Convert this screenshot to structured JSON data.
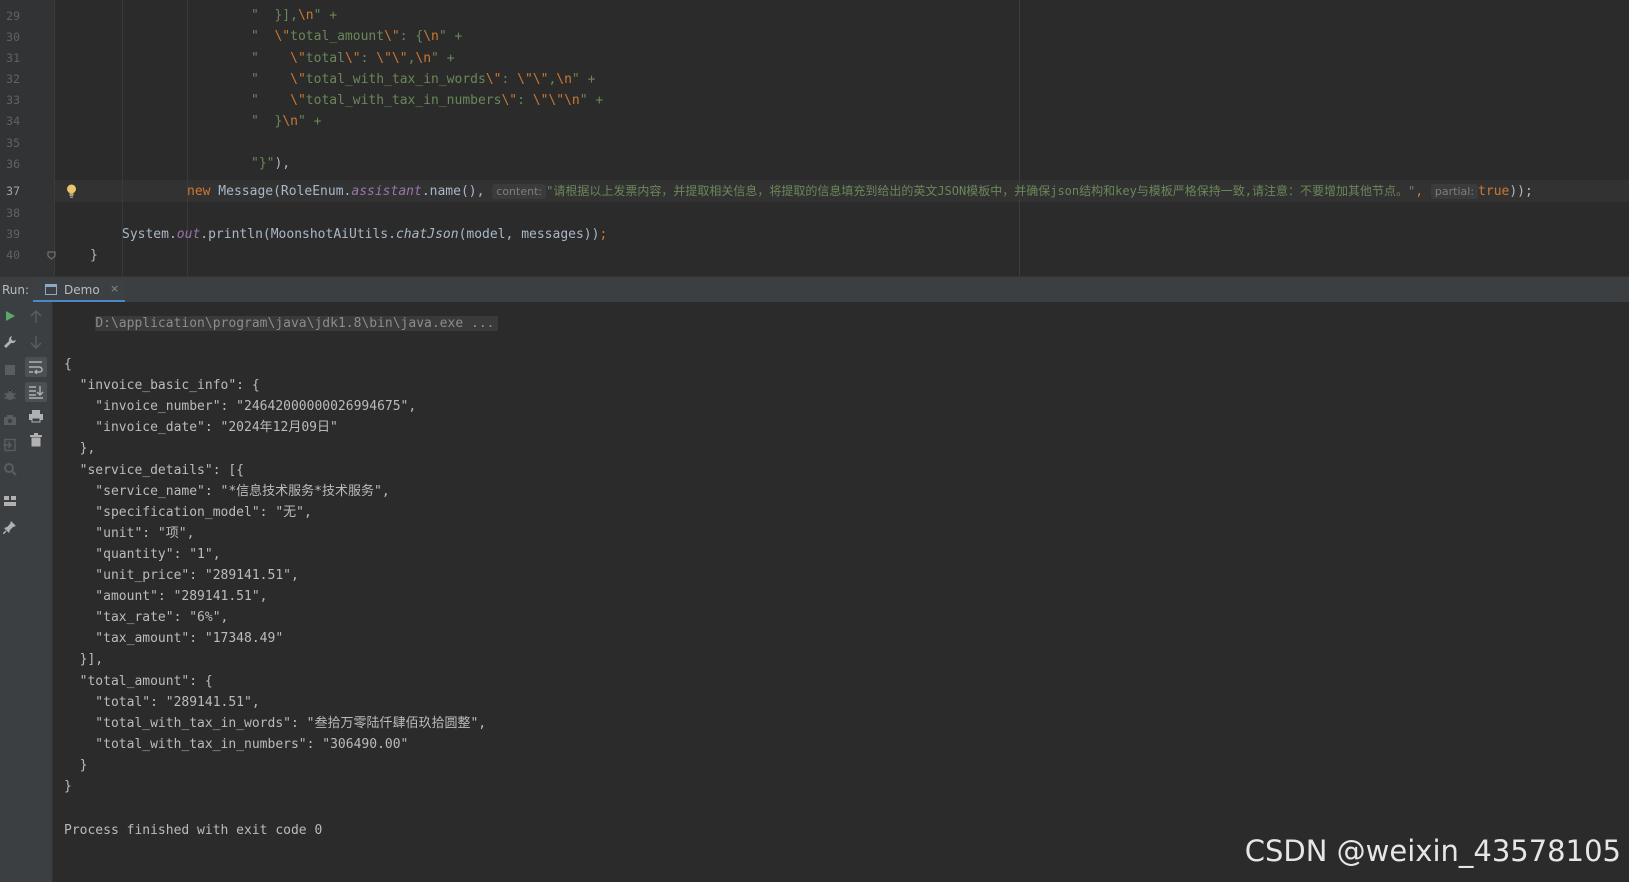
{
  "editor": {
    "line_numbers": [
      "29",
      "30",
      "31",
      "32",
      "33",
      "34",
      "35",
      "36",
      "37",
      "38",
      "39",
      "40"
    ],
    "current_line": "37",
    "lines": {
      "l29": {
        "q": "\"  ",
        "brace": "}],",
        "esc": "\\n",
        "end": "\" +"
      },
      "l30": {
        "q": "\"  ",
        "esc1": "\\\"",
        "key": "total_amount",
        "esc2": "\\\"",
        "mid": ": {",
        "esc3": "\\n",
        "end": "\" +"
      },
      "l31": {
        "q": "\"    ",
        "esc1": "\\\"",
        "key": "total",
        "esc2": "\\\"",
        "mid": ": ",
        "esc3": "\\\"\\\"",
        "comma": ",",
        "esc4": "\\n",
        "end": "\" +"
      },
      "l32": {
        "q": "\"    ",
        "esc1": "\\\"",
        "key": "total_with_tax_in_words",
        "esc2": "\\\"",
        "mid": ": ",
        "esc3": "\\\"\\\"",
        "comma": ",",
        "esc4": "\\n",
        "end": "\" +"
      },
      "l33": {
        "q": "\"    ",
        "esc1": "\\\"",
        "key": "total_with_tax_in_numbers",
        "esc2": "\\\"",
        "mid": ": ",
        "esc3": "\\\"\\\"",
        "esc4": "\\n",
        "end": "\" +"
      },
      "l34": {
        "q": "\"  ",
        "brace": "}",
        "esc": "\\n",
        "end": "\" +"
      },
      "l36": {
        "str": "\"}\"",
        "end": "),"
      },
      "l37": {
        "kw_new": "new",
        "cls": " Message(RoleEnum.",
        "field": "assistant",
        "call": ".name(),",
        "hint_content": "content:",
        "content_str": "\"请根据以上发票内容，并提取相关信息，将提取的信息填充到给出的英文JSON模板中，并确保json结构和key与模板严格保持一致,请注意：不要增加其他节点。\"",
        "comma": ",",
        "hint_partial": "partial:",
        "kw_true": "true",
        "end": "));"
      },
      "l39": {
        "sys": "System.",
        "out": "out",
        "println": ".println(MoonshotAiUtils.",
        "method": "chatJson",
        "args": "(model, messages))",
        "semi": ";"
      },
      "l40": {
        "brace": "}"
      }
    }
  },
  "run_window": {
    "label": "Run:",
    "tab": {
      "label": "Demo",
      "close": "×"
    },
    "tool_icons": [
      "rerun-icon",
      "up-arrow-icon",
      "down-arrow-icon",
      "soft-wrap-icon",
      "scroll-to-end-icon",
      "print-icon",
      "trash-icon",
      "wrench-icon",
      "stop-icon",
      "debug-icon",
      "camera-icon",
      "exit-icon",
      "settings-icon",
      "layout-icon",
      "pin-icon"
    ]
  },
  "console": {
    "command": "D:\\application\\program\\java\\jdk1.8\\bin\\java.exe ...",
    "output_lines": [
      "{",
      "  \"invoice_basic_info\": {",
      "    \"invoice_number\": \"24642000000026994675\",",
      "    \"invoice_date\": \"2024年12月09日\"",
      "  },",
      "  \"service_details\": [{",
      "    \"service_name\": \"*信息技术服务*技术服务\",",
      "    \"specification_model\": \"无\",",
      "    \"unit\": \"项\",",
      "    \"quantity\": \"1\",",
      "    \"unit_price\": \"289141.51\",",
      "    \"amount\": \"289141.51\",",
      "    \"tax_rate\": \"6%\",",
      "    \"tax_amount\": \"17348.49\"",
      "  }],",
      "  \"total_amount\": {",
      "    \"total\": \"289141.51\",",
      "    \"total_with_tax_in_words\": \"叁拾万零陆仟肆佰玖拾圆整\",",
      "    \"total_with_tax_in_numbers\": \"306490.00\"",
      "  }",
      "}"
    ],
    "process_finished": "Process finished with exit code 0"
  },
  "watermark": "CSDN @weixin_43578105",
  "colors": {
    "string": "#6a8759",
    "keyword": "#cc7832",
    "field": "#9876aa",
    "accent": "#4a88c7",
    "run_green": "#59a869"
  }
}
